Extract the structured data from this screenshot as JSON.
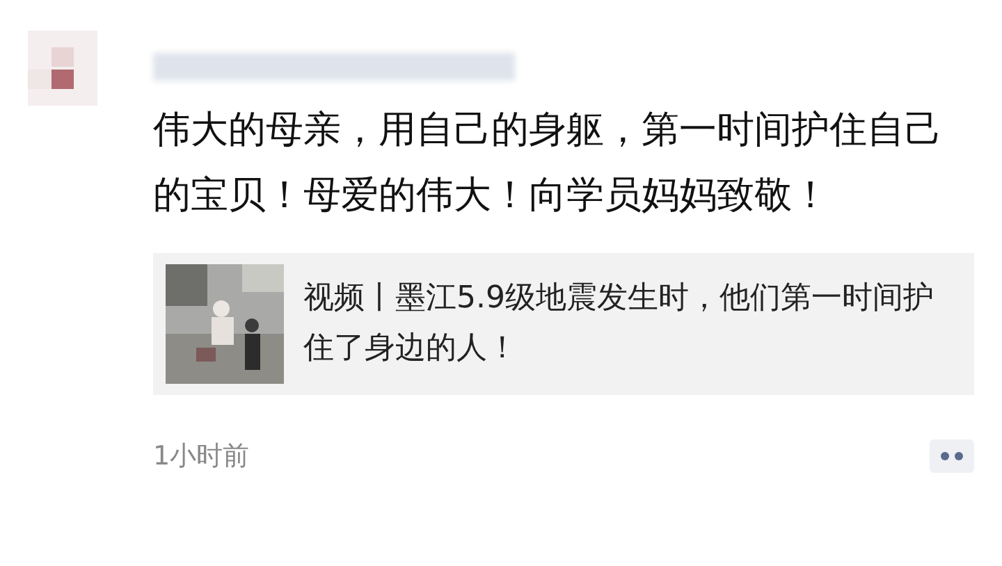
{
  "post": {
    "text": "伟大的母亲，用自己的身躯，第一时间护住自己的宝贝！母爱的伟大！向学员妈妈致敬！",
    "link_card": {
      "title": "视频丨墨江5.9级地震发生时，他们第一时间护住了身边的人！"
    },
    "time": "1小时前"
  }
}
